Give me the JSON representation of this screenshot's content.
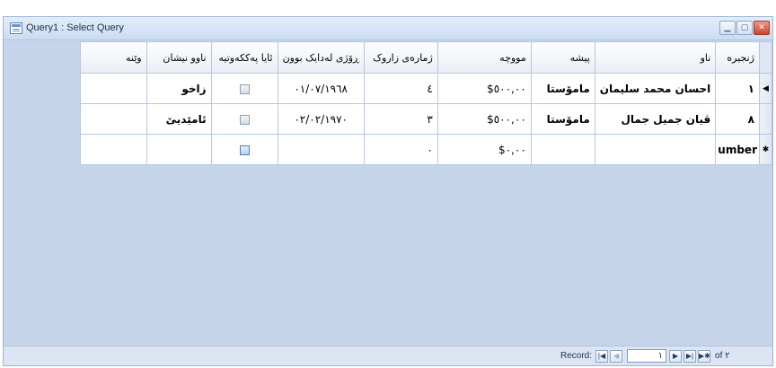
{
  "window": {
    "title": "Query1 : Select Query"
  },
  "columns": [
    "وێنە",
    "ناو‌و نیشان",
    "ئایا پەککەوتیە",
    "ڕۆژی لەدایک بوون",
    "ژمارەی زاروک",
    "مووچە",
    "پیشە",
    "ناو",
    "ژنجیرە"
  ],
  "rows": [
    {
      "photo": "",
      "address": "زاخو",
      "disabled": false,
      "birth": "٠١/٠٧/١٩٦٨",
      "children": "٤",
      "salary": "$٥٠٠,٠٠",
      "job": "مامۆستا",
      "name": "احسان محمد سليمان",
      "serial": "١"
    },
    {
      "photo": "",
      "address": "ئامێدیێ",
      "disabled": false,
      "birth": "٠٢/٠٢/١٩٧٠",
      "children": "٣",
      "salary": "$٥٠٠,٠٠",
      "job": "مامۆستا",
      "name": "ڤیان جمیل جمال",
      "serial": "٨"
    }
  ],
  "new_row": {
    "children": "٠",
    "salary": "$٠,٠٠",
    "serial": "umber"
  },
  "statusbar": {
    "record_label": "Record:",
    "current": "١",
    "of_label": "of ٢"
  }
}
